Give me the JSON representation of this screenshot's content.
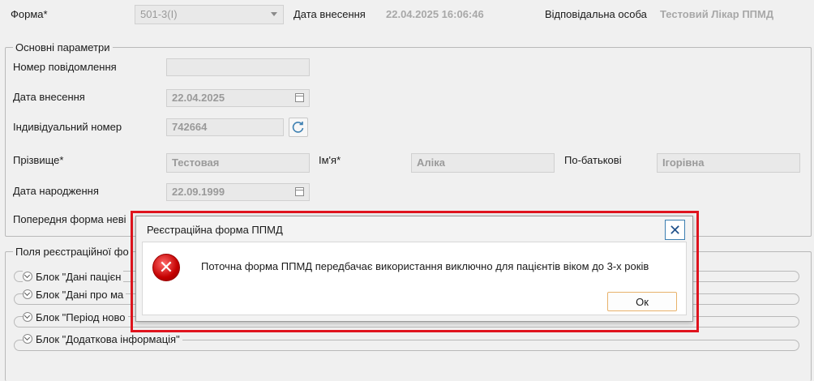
{
  "header": {
    "form_label": "Форма*",
    "form_value": "501-3(I)",
    "date_label": "Дата внесення",
    "date_value": "22.04.2025 16:06:46",
    "responsible_label": "Відповідальна особа",
    "responsible_value": "Тестовий Лікар ППМД"
  },
  "main_params": {
    "legend": "Основні параметри",
    "message_number_label": "Номер повідомлення",
    "message_number_value": "",
    "entry_date_label": "Дата внесення",
    "entry_date_value": "22.04.2025",
    "individual_number_label": "Індивідуальний номер",
    "individual_number_value": "742664",
    "surname_label": "Прізвище*",
    "surname_value": "Тестовая",
    "name_label": "Ім'я*",
    "name_value": "Аліка",
    "patronymic_label": "По-батькові",
    "patronymic_value": "Ігорівна",
    "birth_date_label": "Дата народження",
    "birth_date_value": "22.09.1999",
    "prev_form_label": "Попередня форма неві"
  },
  "reg_fields": {
    "legend": "Поля реєстраційної фо",
    "blocks": [
      "Блок \"Дані пацієн",
      "Блок \"Дані про ма",
      "Блок \"Період ново",
      "Блок \"Додаткова інформація\""
    ]
  },
  "dialog": {
    "title": "Реєстраційна форма ППМД",
    "message": "Поточна форма ППМД передбачає використання виключно для пацієнтів віком до 3-х років",
    "ok_label": "Ок",
    "close_glyph": "✕",
    "error_glyph": "✕",
    "highlight_color": "#e0141e"
  }
}
